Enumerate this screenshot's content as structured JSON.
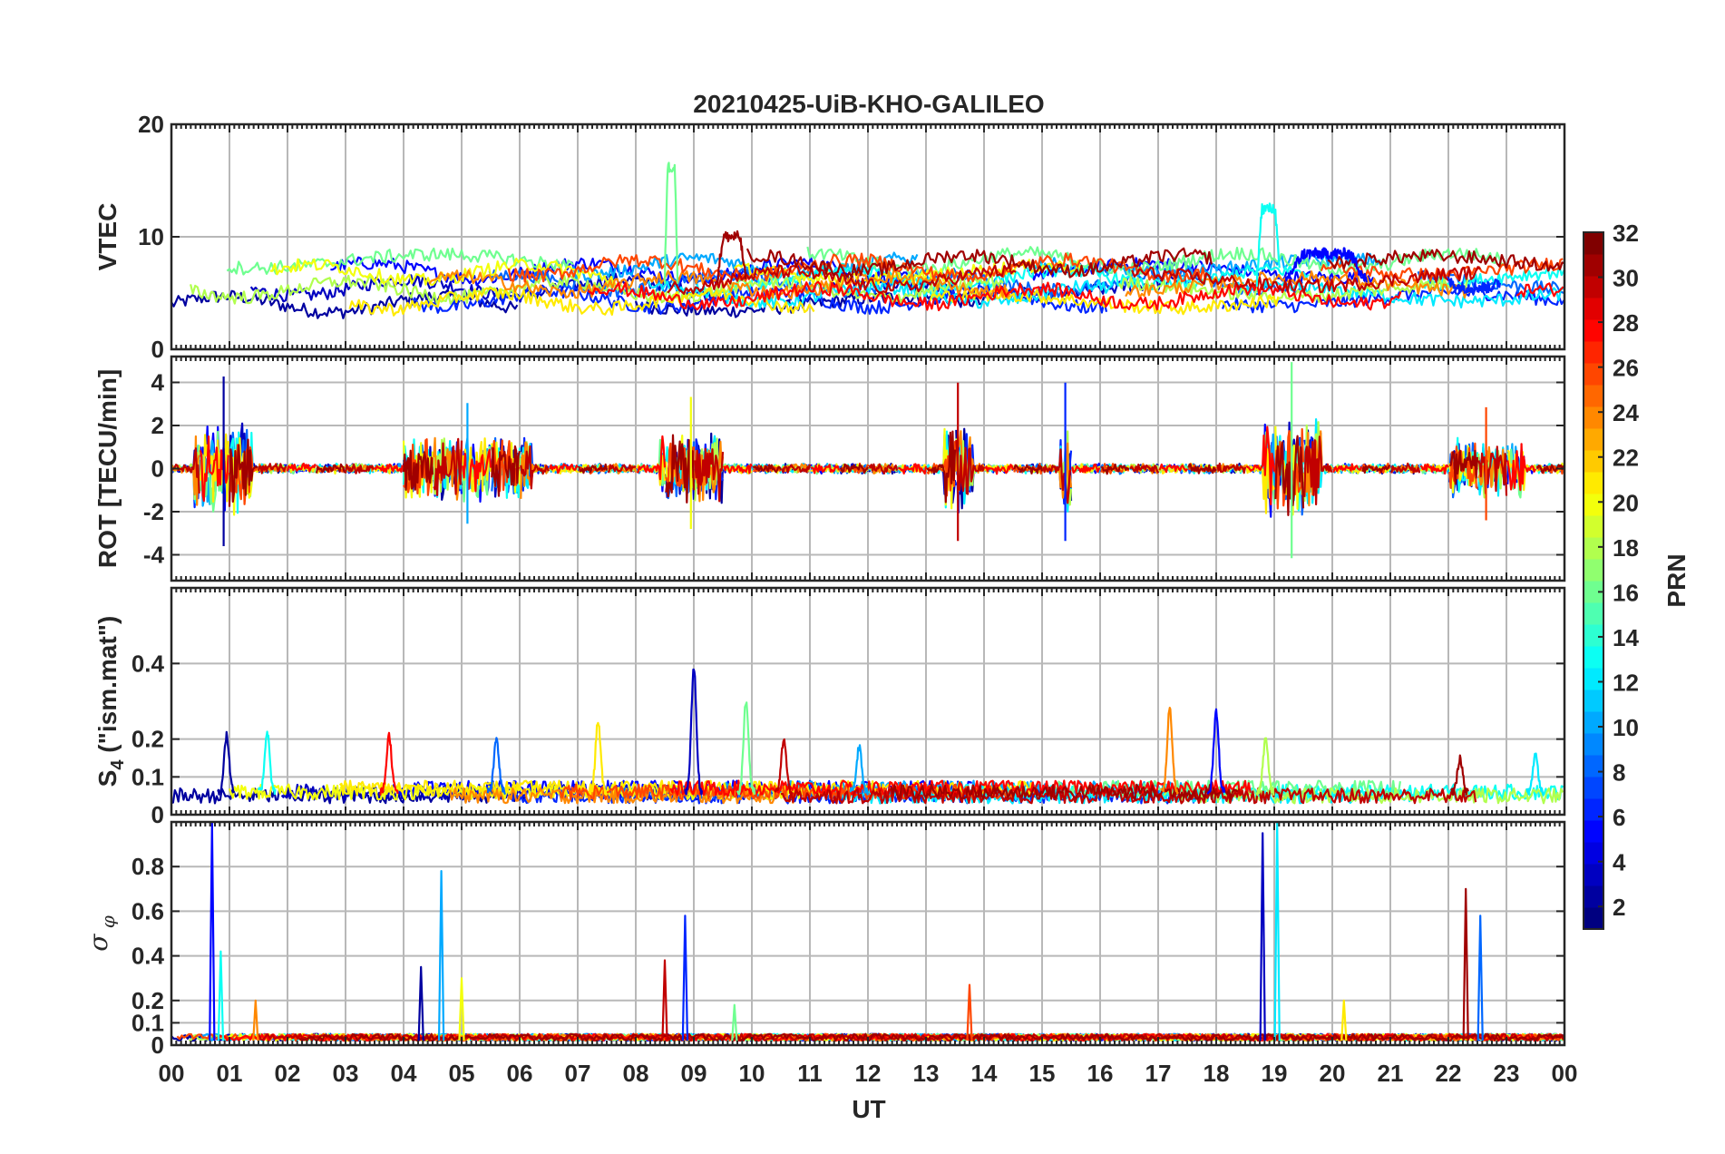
{
  "chart_data": [
    {
      "type": "line",
      "title": "20210425-UiB-KHO-GALILEO",
      "ylabel": "VTEC",
      "ylim": [
        0,
        20
      ],
      "yticks": [
        0,
        10,
        20
      ],
      "x_unit": "UT hour",
      "xlim": [
        0,
        24
      ],
      "series_color_scale": "PRN",
      "events": [
        {
          "prn": 16,
          "x": [
            8.5,
            8.72
          ],
          "peak": 16.2
        },
        {
          "prn": 31,
          "x": [
            9.4,
            9.9
          ],
          "peak": 10.0
        },
        {
          "prn": 13,
          "x": [
            18.7,
            19.1
          ],
          "peak": 12.5
        },
        {
          "prn": 5,
          "x": [
            19.2,
            20.6
          ],
          "peak": 8.5
        },
        {
          "prn": 6,
          "x": [
            22.0,
            22.9
          ],
          "peak": 5.5
        }
      ],
      "baseline_range": [
        4,
        8
      ]
    },
    {
      "type": "line",
      "ylabel": "ROT [TECU/min]",
      "ylim": [
        -5.2,
        5.2
      ],
      "yticks": [
        -4,
        -2,
        0,
        2,
        4
      ],
      "xlim": [
        0,
        24
      ],
      "active_periods": [
        {
          "x": [
            0.4,
            1.4
          ],
          "amp": 4.5
        },
        {
          "x": [
            4.0,
            6.2
          ],
          "amp": 3.2
        },
        {
          "x": [
            8.4,
            9.5
          ],
          "amp": 3.5
        },
        {
          "x": [
            13.3,
            13.8
          ],
          "amp": 4.2
        },
        {
          "x": [
            15.3,
            15.5
          ],
          "amp": 4.2
        },
        {
          "x": [
            18.8,
            19.8
          ],
          "amp": 5.2
        },
        {
          "x": [
            22.0,
            23.3
          ],
          "amp": 3.0
        }
      ]
    },
    {
      "type": "line",
      "ylabel": "S_4 (\"ism.mat\")",
      "ylim": [
        0,
        0.6
      ],
      "yticks": [
        0,
        0.1,
        0.2,
        0.4
      ],
      "xlim": [
        0,
        24
      ],
      "peaks": [
        {
          "x": 0.95,
          "y": 0.21
        },
        {
          "x": 1.65,
          "y": 0.22
        },
        {
          "x": 3.75,
          "y": 0.21
        },
        {
          "x": 5.6,
          "y": 0.2
        },
        {
          "x": 7.35,
          "y": 0.25
        },
        {
          "x": 9.0,
          "y": 0.39
        },
        {
          "x": 9.9,
          "y": 0.3
        },
        {
          "x": 10.55,
          "y": 0.2
        },
        {
          "x": 11.85,
          "y": 0.18
        },
        {
          "x": 17.2,
          "y": 0.28
        },
        {
          "x": 18.0,
          "y": 0.27
        },
        {
          "x": 18.85,
          "y": 0.2
        },
        {
          "x": 22.2,
          "y": 0.15
        },
        {
          "x": 23.5,
          "y": 0.16
        }
      ],
      "baseline": 0.06
    },
    {
      "type": "line",
      "ylabel": "σ_φ",
      "ylim": [
        0,
        1
      ],
      "yticks": [
        0,
        0.1,
        0.2,
        0.4,
        0.6,
        0.8
      ],
      "xlim": [
        0,
        24
      ],
      "peaks": [
        {
          "x": 0.7,
          "y": 1.0
        },
        {
          "x": 0.85,
          "y": 0.42
        },
        {
          "x": 1.45,
          "y": 0.2
        },
        {
          "x": 4.3,
          "y": 0.35
        },
        {
          "x": 4.65,
          "y": 0.78
        },
        {
          "x": 5.0,
          "y": 0.3
        },
        {
          "x": 8.5,
          "y": 0.38
        },
        {
          "x": 8.85,
          "y": 0.58
        },
        {
          "x": 9.7,
          "y": 0.18
        },
        {
          "x": 13.75,
          "y": 0.27
        },
        {
          "x": 18.8,
          "y": 0.95
        },
        {
          "x": 19.05,
          "y": 1.0
        },
        {
          "x": 20.2,
          "y": 0.2
        },
        {
          "x": 22.3,
          "y": 0.7
        },
        {
          "x": 22.55,
          "y": 0.58
        }
      ]
    }
  ],
  "xaxis": {
    "label": "UT",
    "ticks": [
      "00",
      "01",
      "02",
      "03",
      "04",
      "05",
      "06",
      "07",
      "08",
      "09",
      "10",
      "11",
      "12",
      "13",
      "14",
      "15",
      "16",
      "17",
      "18",
      "19",
      "20",
      "21",
      "22",
      "23",
      "00"
    ]
  },
  "colorbar": {
    "label": "PRN",
    "min": 1,
    "max": 32,
    "ticks": [
      2,
      4,
      6,
      8,
      10,
      12,
      14,
      16,
      18,
      20,
      22,
      24,
      26,
      28,
      30,
      32
    ],
    "colormap": "jet"
  }
}
